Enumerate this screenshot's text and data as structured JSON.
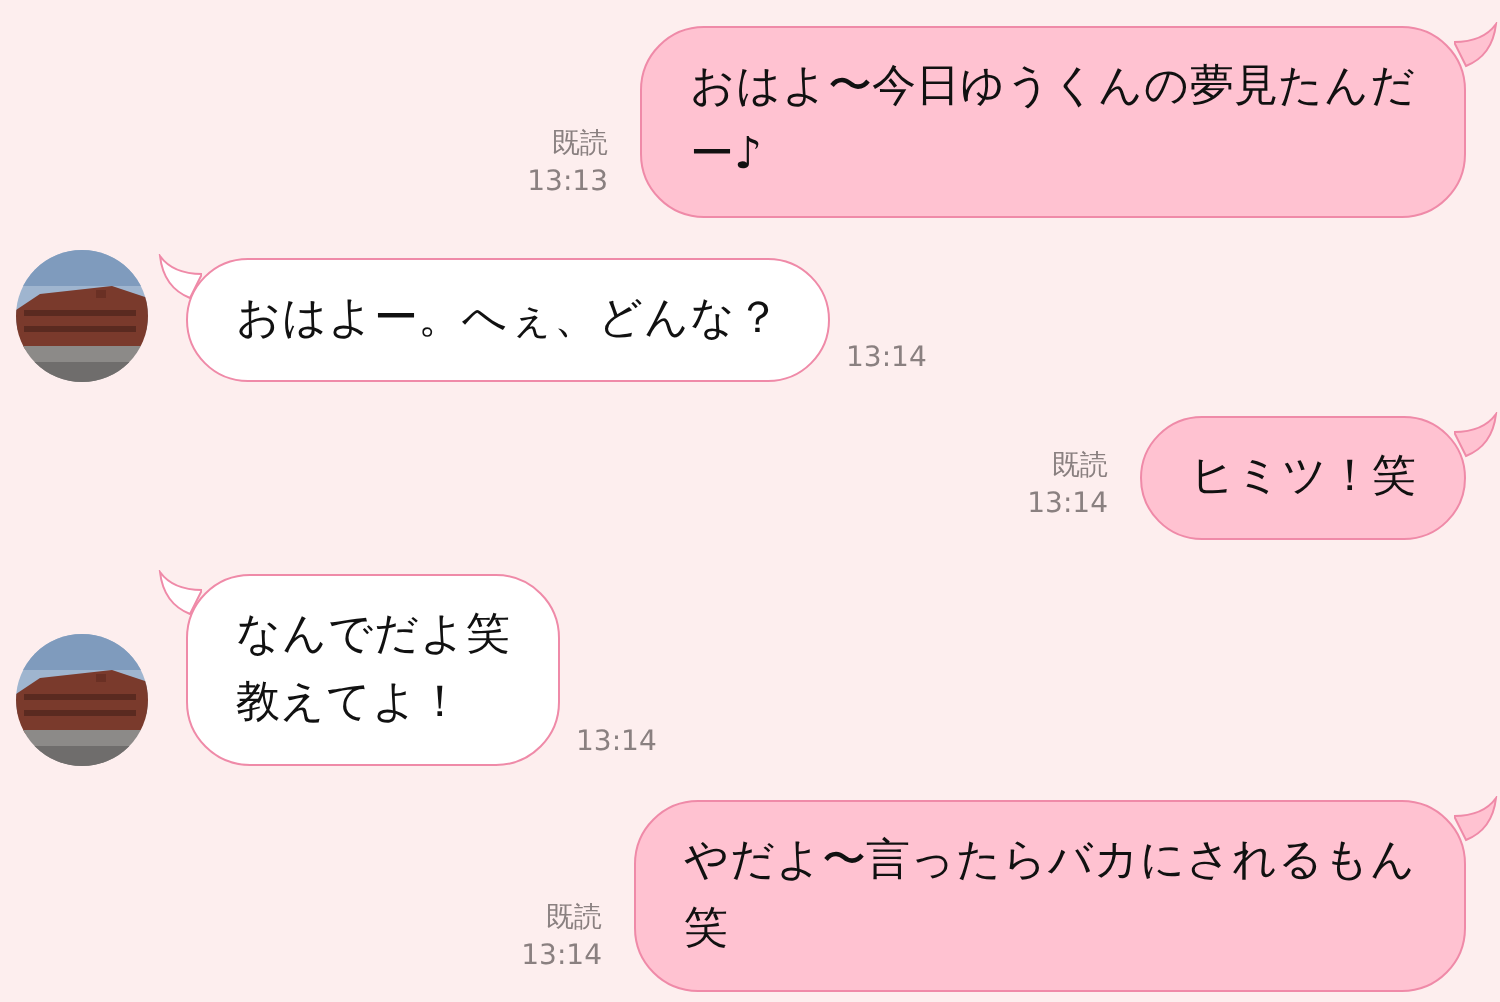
{
  "messages": [
    {
      "kind": "sent",
      "lines": [
        "おはよ〜今日ゆうくんの夢見たんだ",
        "ー♪"
      ],
      "read": "既読",
      "time": "13:13"
    },
    {
      "kind": "received",
      "lines": [
        "おはよー。へぇ、どんな？"
      ],
      "time": "13:14"
    },
    {
      "kind": "sent",
      "lines": [
        "ヒミツ！笑"
      ],
      "read": "既読",
      "time": "13:14"
    },
    {
      "kind": "received",
      "lines": [
        "なんでだよ笑",
        "教えてよ！"
      ],
      "time": "13:14"
    },
    {
      "kind": "sent",
      "lines": [
        "やだよ〜言ったらバカにされるもん",
        "笑"
      ],
      "read": "既読",
      "time": "13:14"
    }
  ]
}
